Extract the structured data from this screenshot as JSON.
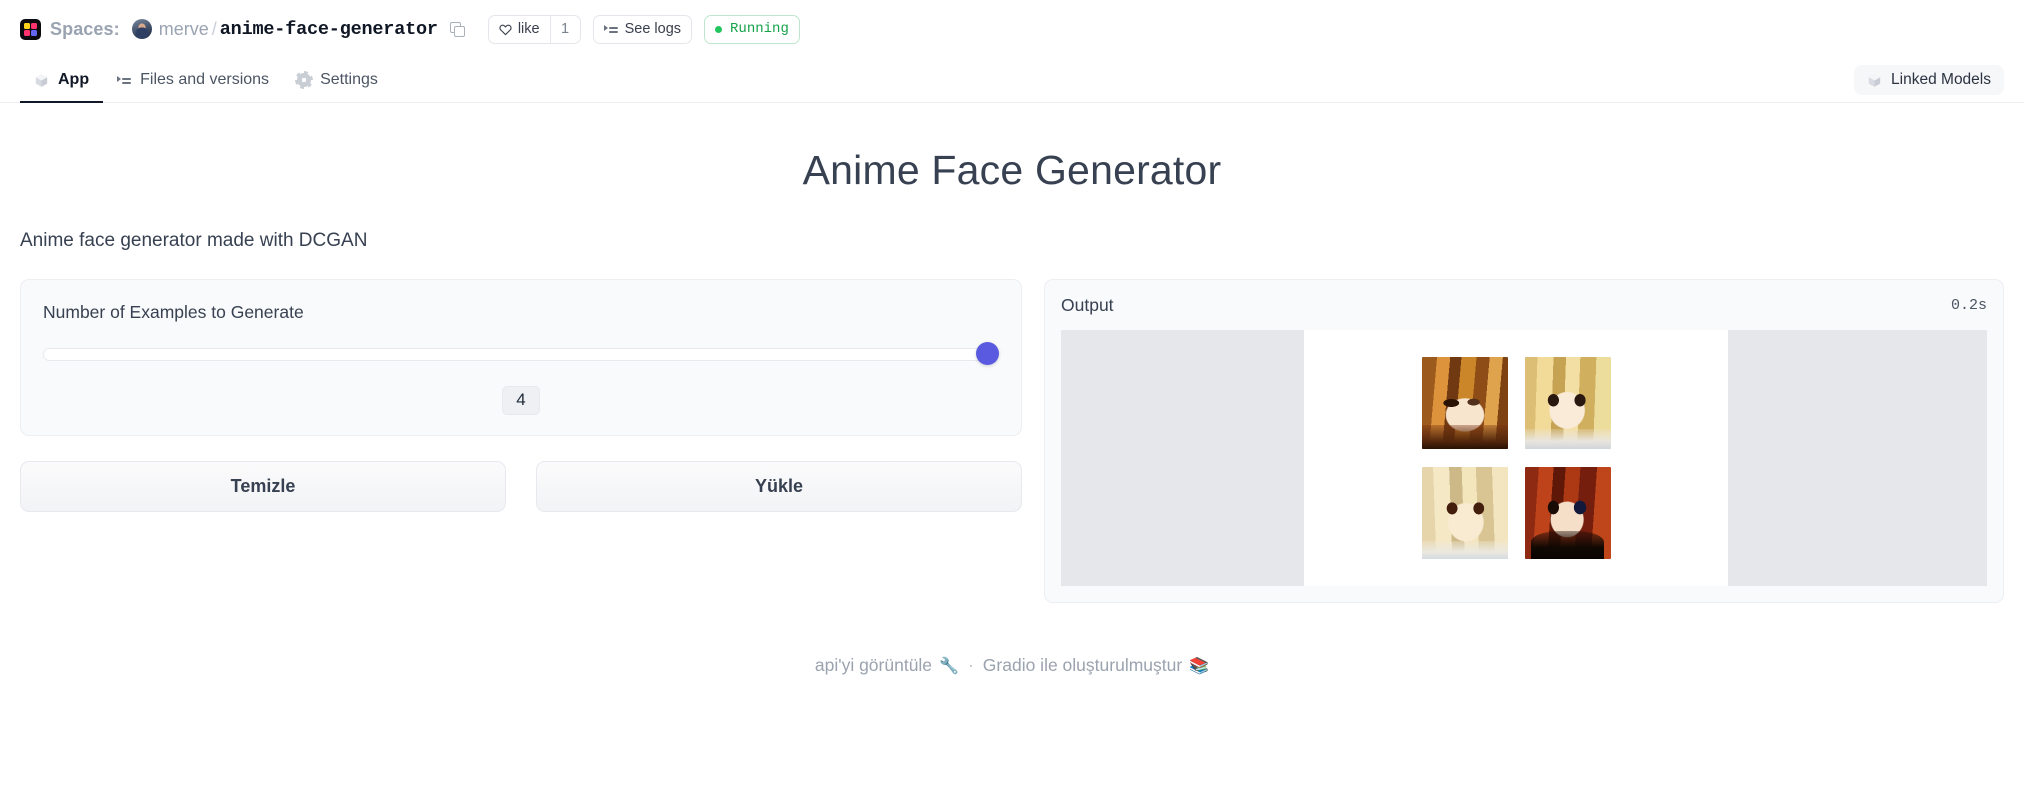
{
  "header": {
    "spaces_label": "Spaces:",
    "owner": "merve",
    "separator": "/",
    "repo": "anime-face-generator",
    "copy_icon": "copy-icon",
    "like_label": "like",
    "like_count": "1",
    "logs_label": "See logs",
    "status_label": "Running",
    "status_color": "#15a34a"
  },
  "nav": {
    "tabs": [
      {
        "label": "App",
        "icon": "cube-icon",
        "active": true
      },
      {
        "label": "Files and versions",
        "icon": "files-icon",
        "active": false
      },
      {
        "label": "Settings",
        "icon": "gear-icon",
        "active": false
      }
    ],
    "linked_models": "Linked Models",
    "linked_models_icon": "cube-icon"
  },
  "app": {
    "title": "Anime Face Generator",
    "description": "Anime face generator made with DCGAN"
  },
  "controls": {
    "slider_label": "Number of Examples to Generate",
    "slider_value": "4",
    "slider_percent": 100,
    "clear_button": "Temizle",
    "submit_button": "Yükle"
  },
  "output": {
    "title": "Output",
    "duration": "0.2s",
    "images": [
      {
        "name": "anime-face-1",
        "alt": "brown haired anime face"
      },
      {
        "name": "anime-face-2",
        "alt": "blonde anime face with large eyes"
      },
      {
        "name": "anime-face-3",
        "alt": "light blonde anime face with red eyes"
      },
      {
        "name": "anime-face-4",
        "alt": "auburn anime face with blue eye"
      }
    ]
  },
  "footer": {
    "api_link": "api'yi görüntüle",
    "wrench_icon": "🔧",
    "separator": "·",
    "built_with": "Gradio ile oluşturulmuştur",
    "gradio_icon": "📚"
  },
  "colors": {
    "accent": "#5a5ae0",
    "running": "#15a34a",
    "placeholder": "#e5e7eb"
  }
}
